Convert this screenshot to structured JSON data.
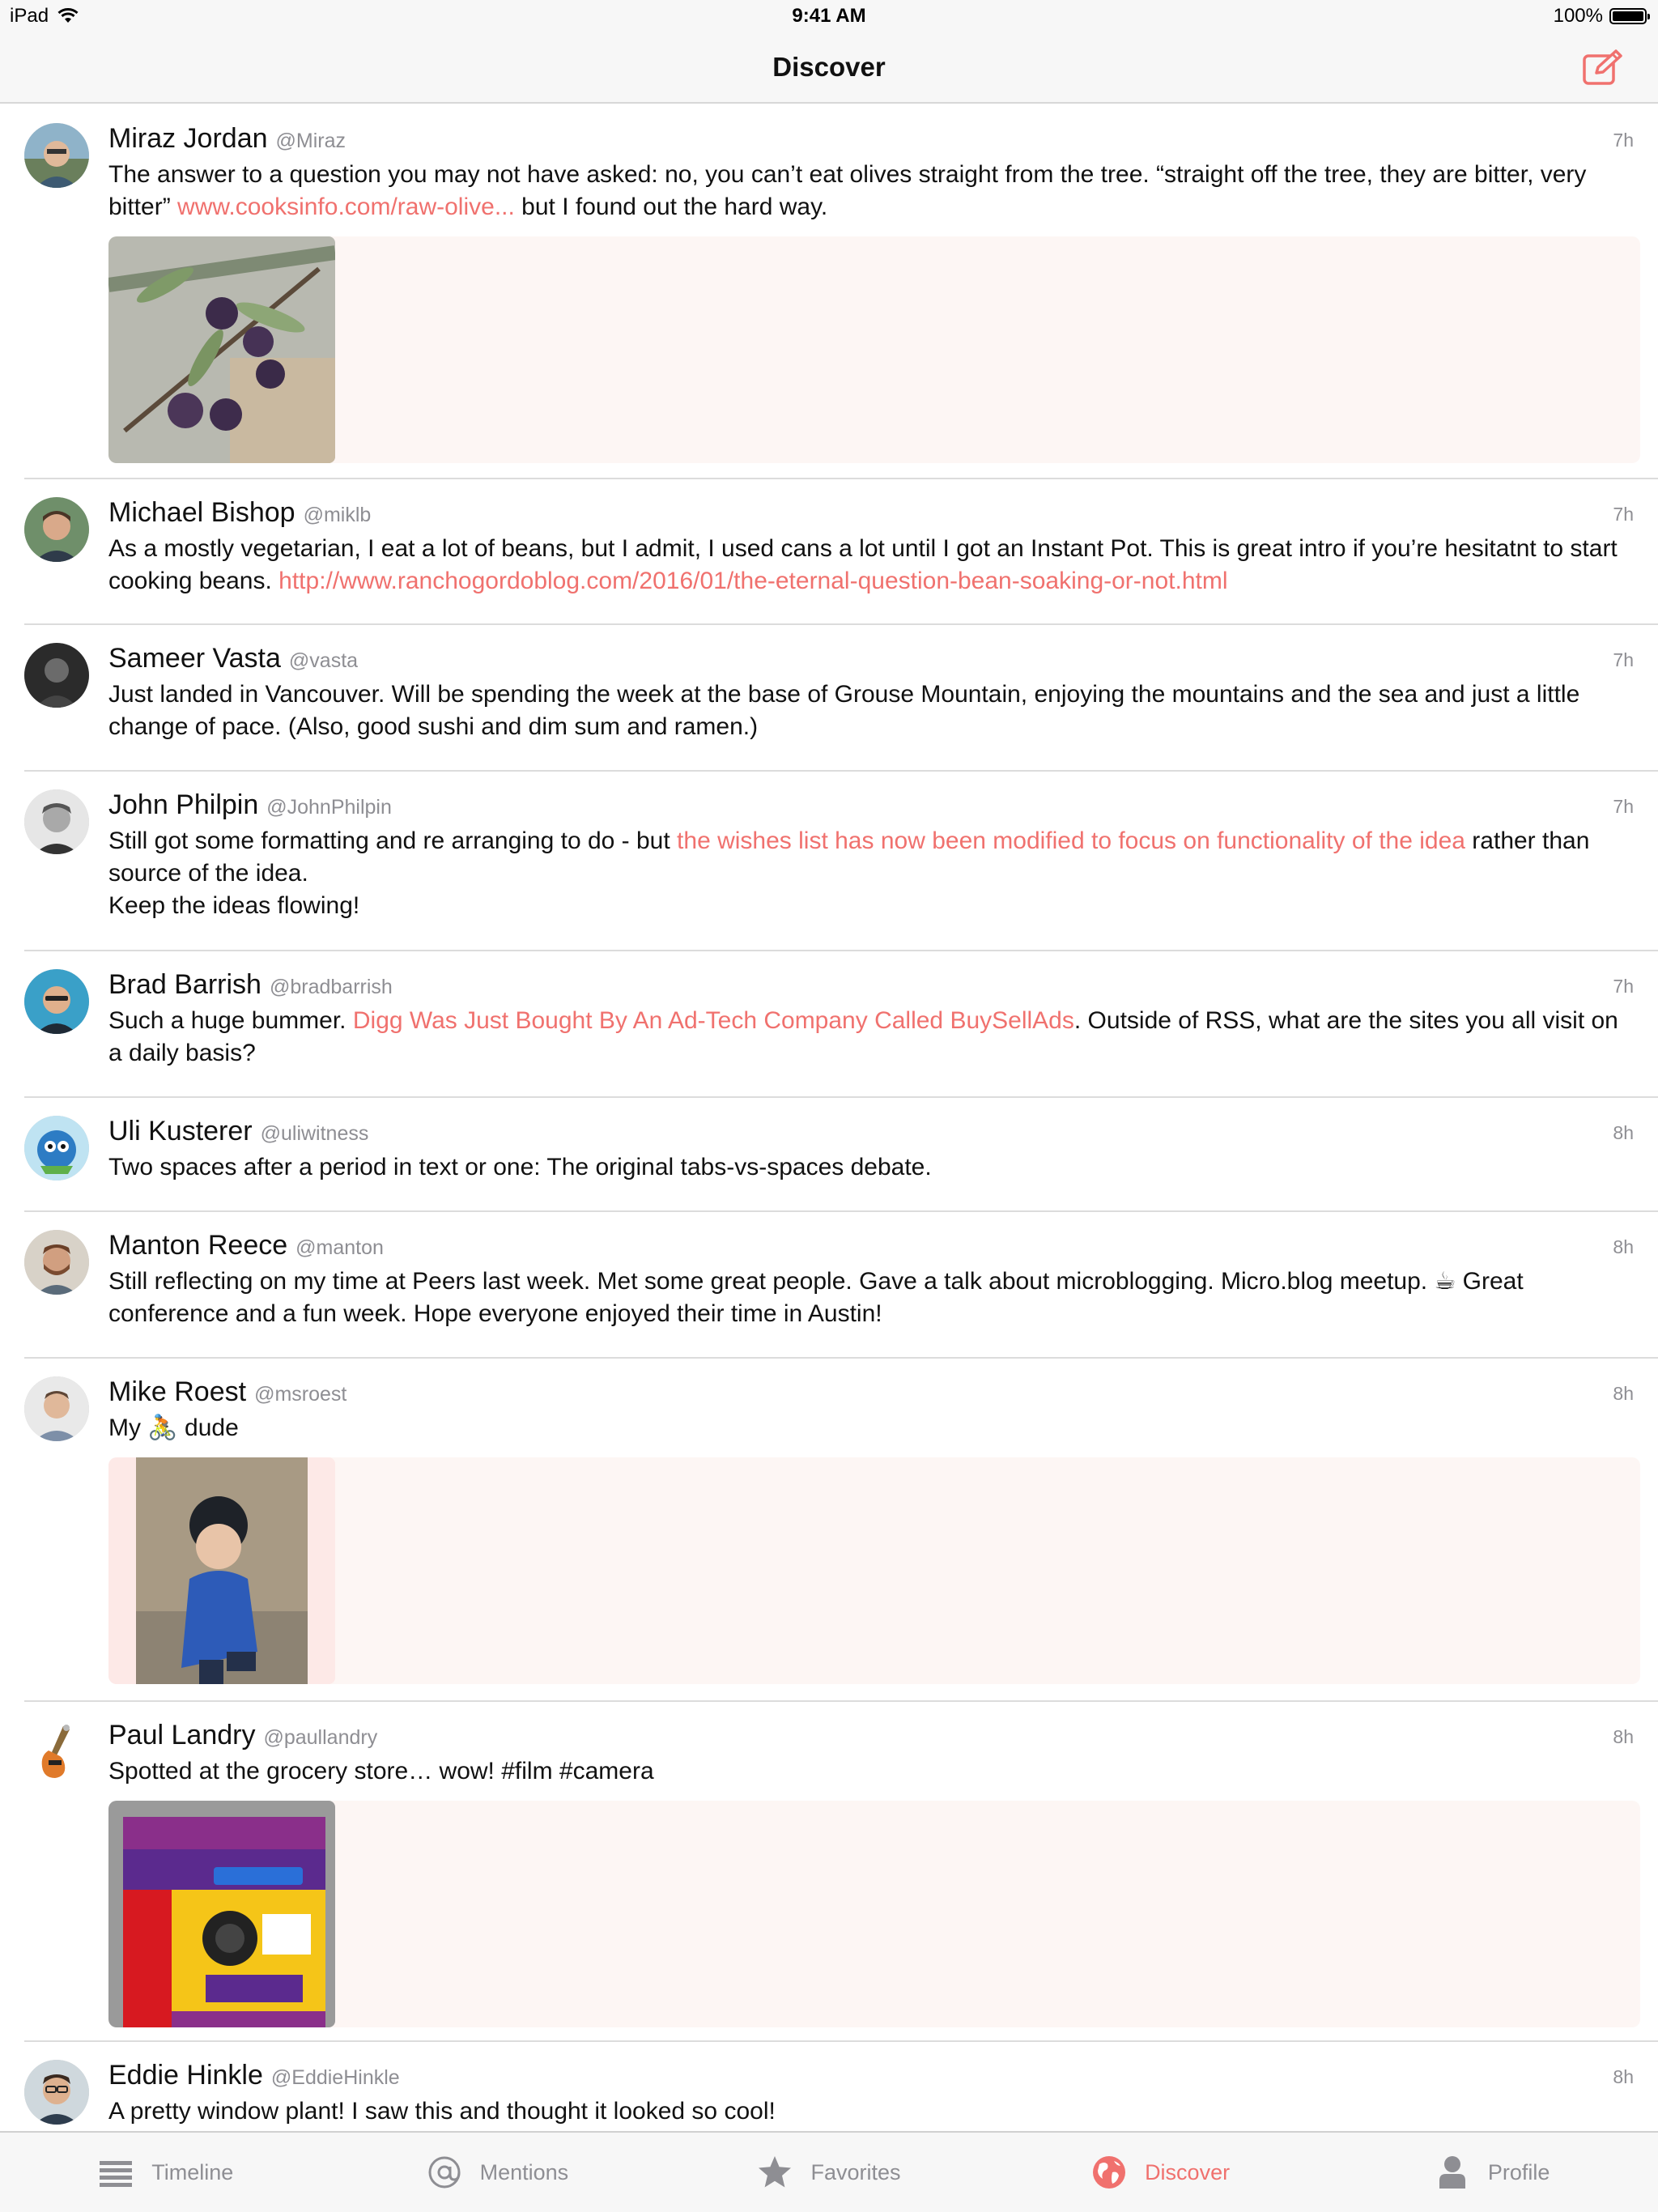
{
  "status_bar": {
    "device": "iPad",
    "time": "9:41 AM",
    "battery": "100%"
  },
  "nav": {
    "title": "Discover",
    "compose_icon": "compose-icon"
  },
  "posts": [
    {
      "author": "Miraz Jordan",
      "handle": "@Miraz",
      "time": "7h",
      "text_before": "The answer to a question you may not have asked: no, you can’t eat olives straight from the tree. “straight off the tree, they are bitter, very bitter” ",
      "link": "www.cooksinfo.com/raw-olive...",
      "text_after": " but I found out the hard way."
    },
    {
      "author": "Michael Bishop",
      "handle": "@miklb",
      "time": "7h",
      "text_before": "As a mostly vegetarian, I eat a lot of beans, but I admit, I used cans a lot until I got an Instant Pot. This is great intro if you’re hesitatnt to start cooking beans. ",
      "link": "http://www.ranchogordoblog.com/2016/01/the-eternal-question-bean-soaking-or-not.html",
      "text_after": ""
    },
    {
      "author": "Sameer Vasta",
      "handle": "@vasta",
      "time": "7h",
      "text_before": "Just landed in Vancouver. Will be spending the week at the base of Grouse Mountain, enjoying the mountains and the sea and just a little change of pace. (Also, good sushi and dim sum and ramen.)",
      "link": "",
      "text_after": ""
    },
    {
      "author": "John Philpin",
      "handle": "@JohnPhilpin",
      "time": "7h",
      "text_before": "Still got some formatting and re arranging to do - but ",
      "link": "the wishes list has now been modified to focus on functionality of the idea",
      "text_after": " rather than source of the idea.\nKeep the ideas flowing!"
    },
    {
      "author": "Brad Barrish",
      "handle": "@bradbarrish",
      "time": "7h",
      "text_before": "Such a huge bummer. ",
      "link": "Digg Was Just Bought By An Ad-Tech Company Called BuySellAds",
      "text_after": ". Outside of RSS, what are the sites you all visit on a daily basis?"
    },
    {
      "author": "Uli Kusterer",
      "handle": "@uliwitness",
      "time": "8h",
      "text_before": "Two spaces after a period in text or one: The original tabs-vs-spaces debate.",
      "link": "",
      "text_after": ""
    },
    {
      "author": "Manton Reece",
      "handle": "@manton",
      "time": "8h",
      "text_before": "Still reflecting on my time at Peers last week. Met some great people. Gave a talk about microblogging. Micro.blog meetup. ☕ Great conference and a fun week. Hope everyone enjoyed their time in Austin!",
      "link": "",
      "text_after": ""
    },
    {
      "author": "Mike Roest",
      "handle": "@msroest",
      "time": "8h",
      "text_before": "My 🚴 dude",
      "link": "",
      "text_after": ""
    },
    {
      "author": "Paul Landry",
      "handle": "@paullandry",
      "time": "8h",
      "text_before": "Spotted at the grocery store… wow! #film #camera",
      "link": "",
      "text_after": ""
    },
    {
      "author": "Eddie Hinkle",
      "handle": "@EddieHinkle",
      "time": "8h",
      "text_before": "A pretty window plant! I saw this and thought it looked so cool!",
      "link": "",
      "text_after": ""
    }
  ],
  "tabs": [
    {
      "label": "Timeline",
      "icon": "timeline-icon",
      "active": false
    },
    {
      "label": "Mentions",
      "icon": "at-icon",
      "active": false
    },
    {
      "label": "Favorites",
      "icon": "star-icon",
      "active": false
    },
    {
      "label": "Discover",
      "icon": "globe-icon",
      "active": true
    },
    {
      "label": "Profile",
      "icon": "person-icon",
      "active": false
    }
  ],
  "colors": {
    "accent": "#f0716e",
    "secondary_text": "#8e8e93",
    "bar_bg": "#f7f7f7",
    "media_bg": "#fdf6f4"
  }
}
